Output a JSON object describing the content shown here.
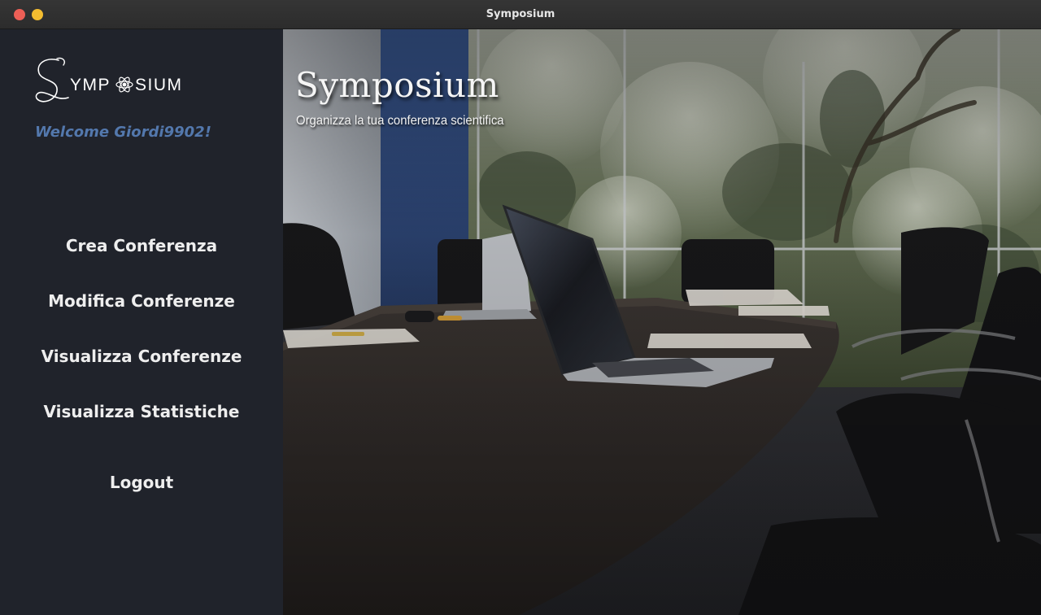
{
  "window": {
    "title": "Symposium"
  },
  "sidebar": {
    "logo_text": "SYMPOSIUM",
    "welcome": "Welcome Giordi9902!",
    "nav": {
      "crea": "Crea Conferenza",
      "modifica": "Modifica Conferenze",
      "visualizza": "Visualizza Conferenze",
      "statistiche": "Visualizza Statistiche",
      "logout": "Logout"
    }
  },
  "hero": {
    "title": "Symposium",
    "subtitle": "Organizza la tua conferenza scientifica"
  },
  "colors": {
    "sidebar_bg": "#20232b",
    "welcome_text": "#5378ad",
    "nav_text": "#eeeeee",
    "close_button": "#ed5f56",
    "minimize_button": "#f4bd30"
  }
}
